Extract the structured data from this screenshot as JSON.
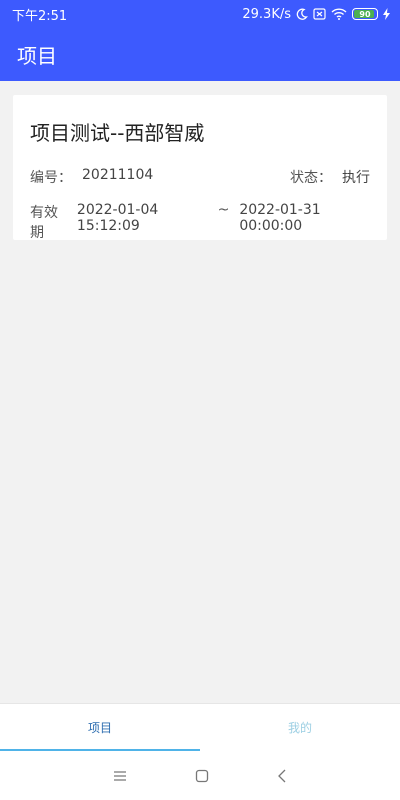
{
  "status_bar": {
    "time": "下午2:51",
    "network_speed": "29.3K/s",
    "battery_level": "90",
    "battery_fraction": 0.9,
    "icons": [
      "moon-icon",
      "sim-off-icon",
      "wifi-icon",
      "battery-icon",
      "charging-icon"
    ]
  },
  "app_bar": {
    "title": "项目"
  },
  "project_card": {
    "title": "项目测试--西部智威",
    "code_label": "编号：",
    "code_value": "20211104",
    "status_label": "状态：",
    "status_value": "执行",
    "validity_label": "有效期",
    "validity_start": "2022-01-04 15:12:09",
    "validity_sep": "~",
    "validity_end": "2022-01-31 00:00:00"
  },
  "tabs": [
    {
      "label": "项目",
      "active": true
    },
    {
      "label": "我的",
      "active": false
    }
  ],
  "nav": {
    "icons": [
      "menu-icon",
      "home-icon",
      "back-icon"
    ]
  },
  "colors": {
    "primary": "#3d5afe",
    "tab_active": "#2f6fb1",
    "tab_inactive": "#9ccfe3",
    "indicator": "#4fb3e8"
  }
}
